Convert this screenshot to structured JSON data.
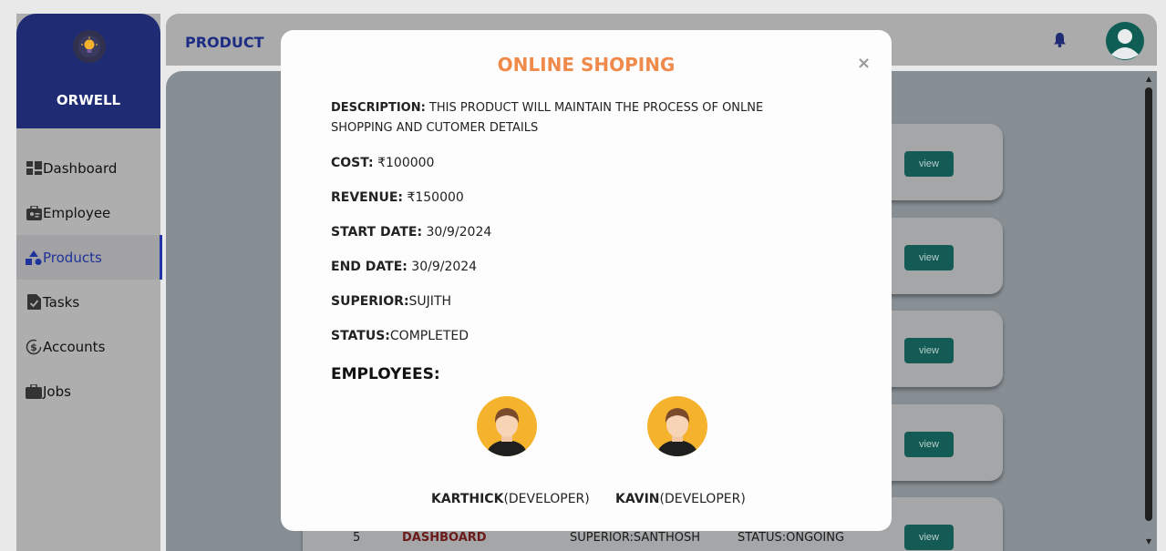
{
  "app": {
    "name": "ORWELL"
  },
  "sidebar": {
    "items": [
      {
        "label": "Dashboard",
        "icon": "dashboard-icon"
      },
      {
        "label": "Employee",
        "icon": "employee-icon"
      },
      {
        "label": "Products",
        "icon": "products-icon",
        "active": true
      },
      {
        "label": "Tasks",
        "icon": "tasks-icon"
      },
      {
        "label": "Accounts",
        "icon": "accounts-icon"
      },
      {
        "label": "Jobs",
        "icon": "jobs-icon"
      }
    ]
  },
  "header": {
    "title": "PRODUCT"
  },
  "list": {
    "view_label": "view",
    "last_row": {
      "number": "5",
      "name": "DASHBOARD",
      "superior": "SUPERIOR:SANTHOSH",
      "status": "STATUS:ONGOING"
    }
  },
  "modal": {
    "title": "ONLINE SHOPING",
    "close": "×",
    "description_label": "DESCRIPTION:",
    "description_value": " THIS PRODUCT WILL MAINTAIN THE PROCESS OF ONLNE SHOPPING AND CUTOMER DETAILS",
    "cost_label": "COST:",
    "cost_value": " ₹100000",
    "revenue_label": "REVENUE:",
    "revenue_value": " ₹150000",
    "start_label": "START DATE:",
    "start_value": " 30/9/2024",
    "end_label": "END DATE:",
    "end_value": " 30/9/2024",
    "superior_label": "SUPERIOR:",
    "superior_value": "SUJITH",
    "status_label": "STATUS:",
    "status_value": "COMPLETED",
    "employees_title": "EMPLOYEES:",
    "employees": [
      {
        "name": "KARTHICK",
        "role": "(DEVELOPER)"
      },
      {
        "name": "KAVIN",
        "role": "(DEVELOPER)"
      }
    ]
  },
  "colors": {
    "brand": "#1f2c74",
    "accent": "#f08a4b",
    "view_button": "#145a55"
  }
}
